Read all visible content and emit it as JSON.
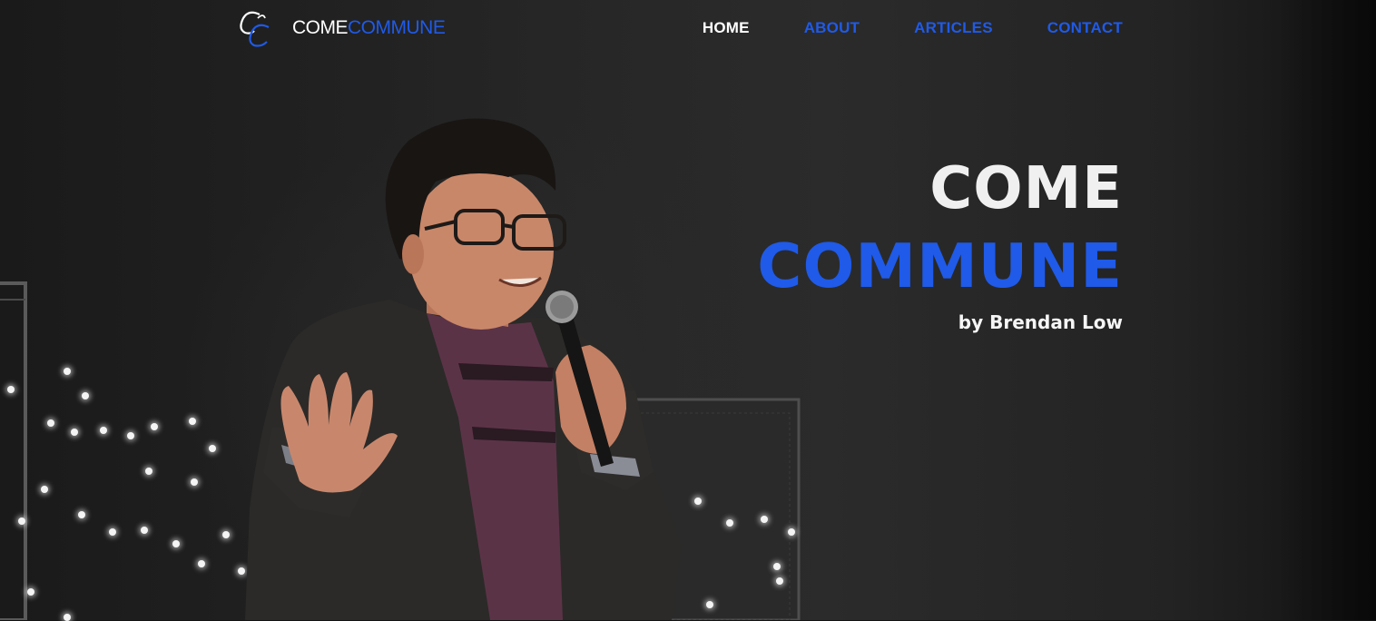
{
  "brand": {
    "name_part1": "COME",
    "name_part2": "COMMUNE",
    "logo_icon": "script-cc-logo-icon"
  },
  "nav": {
    "items": [
      {
        "label": "HOME",
        "active": true
      },
      {
        "label": "ABOUT",
        "active": false
      },
      {
        "label": "ARTICLES",
        "active": false
      },
      {
        "label": "CONTACT",
        "active": false
      }
    ]
  },
  "hero": {
    "title_line1": "COME",
    "title_line2": "COMMUNE",
    "byline": "by Brendan Low",
    "image_subject": "speaker-holding-microphone-on-stage"
  },
  "colors": {
    "accent": "#1f5ae8",
    "text_light": "#f0f0f0",
    "background": "#1a1a1a"
  }
}
